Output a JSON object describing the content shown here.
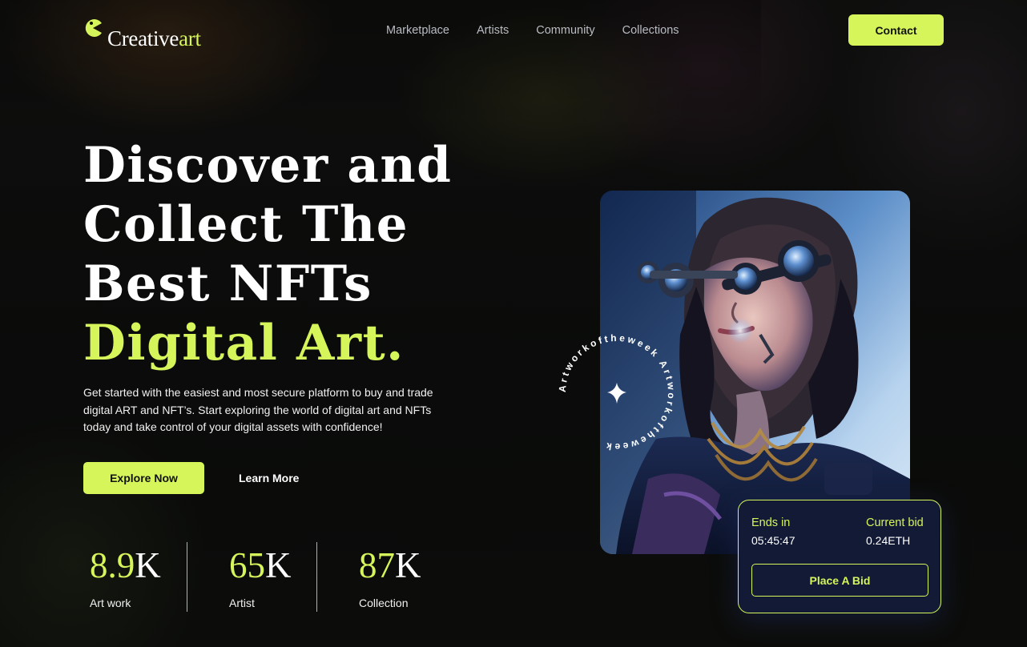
{
  "header": {
    "logo_word": "Creative",
    "logo_accent": "art",
    "nav": [
      "Marketplace",
      "Artists",
      "Community",
      "Collections"
    ],
    "contact_label": "Contact"
  },
  "hero": {
    "title_lines": [
      "Discover and",
      "Collect The",
      "Best NFTs"
    ],
    "title_highlight": "Digital Art.",
    "description": "Get started with the easiest and most secure platform to buy and trade digital ART and NFT’s. Start exploring the world of digital art and NFTs today and take control of your digital assets with confidence!",
    "explore_label": "Explore Now",
    "learn_label": "Learn More"
  },
  "stats": [
    {
      "value": "8.9",
      "suffix": "K",
      "label": "Art work"
    },
    {
      "value": "65",
      "suffix": "K",
      "label": "Artist"
    },
    {
      "value": "87",
      "suffix": "K",
      "label": "Collection"
    }
  ],
  "artwork": {
    "badge_text": "Artworkoftheweek Artworkoftheweek ",
    "ends_label": "Ends in",
    "ends_value": "05:45:47",
    "bid_label": "Current bid",
    "bid_value": "0.24ETH",
    "place_bid_label": "Place A Bid"
  },
  "colors": {
    "accent": "#d6f55a",
    "background": "#0b0c0b",
    "card": "#121a36"
  }
}
